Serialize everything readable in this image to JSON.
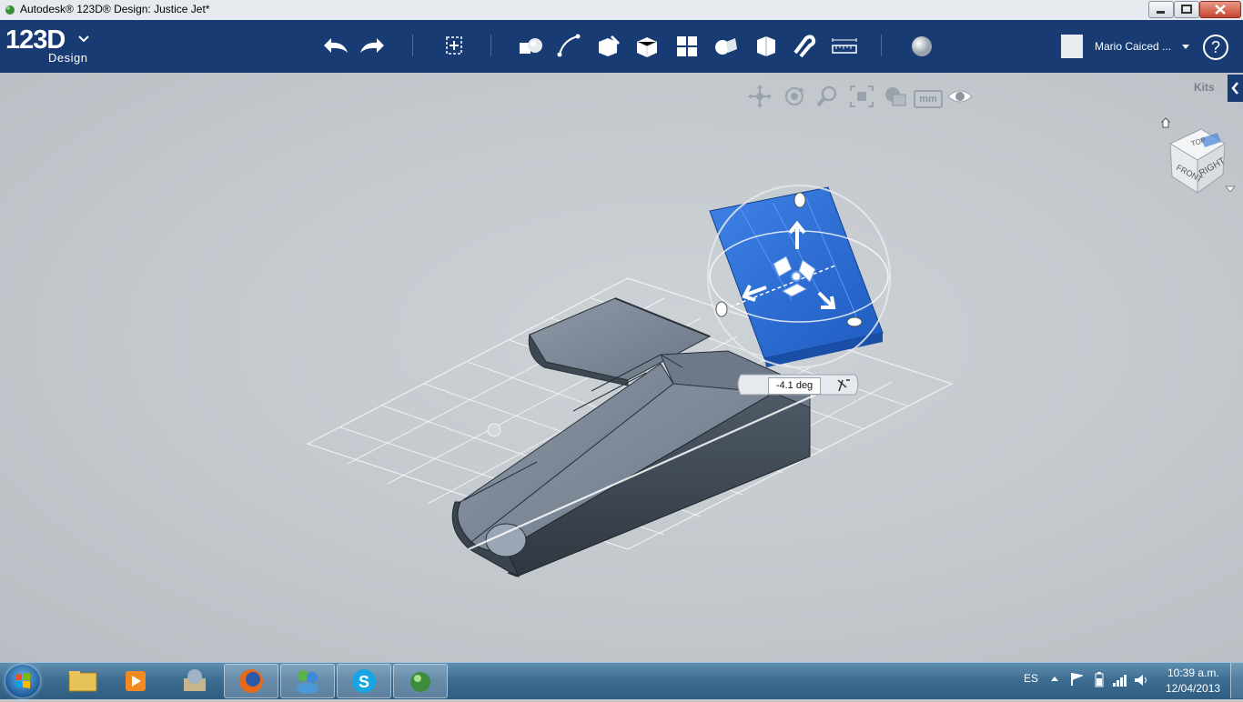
{
  "window": {
    "title": "Autodesk® 123D® Design: Justice Jet*"
  },
  "brand": {
    "logo_main": "123D",
    "logo_sub": "Design"
  },
  "toolbar": {
    "icons": [
      "undo-icon",
      "redo-icon",
      "transform-icon",
      "primitives-icon",
      "sketch-icon",
      "construct-icon",
      "modify-icon",
      "pattern-icon",
      "grouping-icon",
      "combine-icon",
      "snap-icon",
      "measure-icon",
      "material-icon"
    ]
  },
  "user": {
    "name": "Mario Caiced ..."
  },
  "help": {
    "label": "?"
  },
  "viewport": {
    "nav_icons": [
      "pan-icon",
      "orbit-icon",
      "zoom-icon",
      "fit-icon",
      "visual-style-icon",
      "units-icon",
      "visibility-icon"
    ],
    "units_label": "mm",
    "kits_label": "Kits",
    "viewcube": {
      "top": "TOP",
      "front": "FRONT",
      "right": "RIGHT"
    },
    "rotation_value": "-4.1 deg",
    "selected_color": "#2d6fd6",
    "body_color": "#5f6b79"
  },
  "taskbar": {
    "apps": [
      "explorer-icon",
      "media-player-icon",
      "app-icon",
      "firefox-icon",
      "messenger-icon",
      "skype-icon",
      "123d-icon"
    ],
    "language": "ES",
    "time": "10:39 a.m.",
    "date": "12/04/2013"
  }
}
